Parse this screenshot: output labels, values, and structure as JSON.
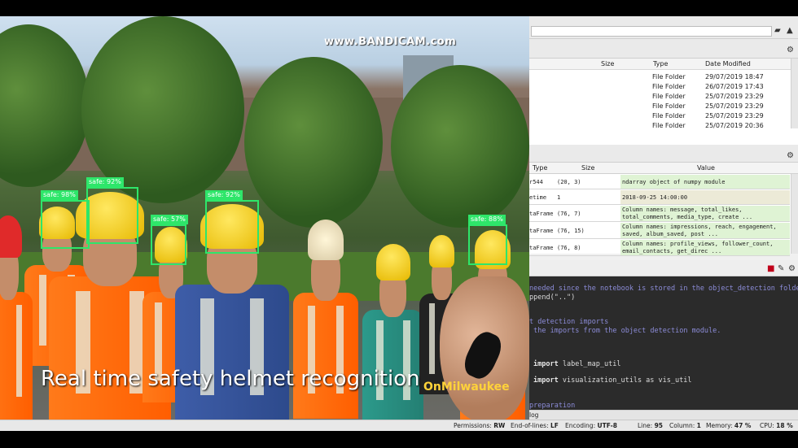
{
  "video": {
    "watermark": "www.BANDICAM.com",
    "caption": "Real time safety helmet recognition",
    "logo_text": "OnMilwaukee",
    "detections": [
      {
        "label": "safe: 98%"
      },
      {
        "label": "safe: 92%"
      },
      {
        "label": "safe: 57%"
      },
      {
        "label": "safe: 92%"
      },
      {
        "label": "safe: 88%"
      }
    ]
  },
  "file_explorer": {
    "columns": {
      "size": "Size",
      "type": "Type",
      "date": "Date Modified"
    },
    "rows": [
      {
        "type": "File Folder",
        "date": "29/07/2019 18:47"
      },
      {
        "type": "File Folder",
        "date": "26/07/2019 17:43"
      },
      {
        "type": "File Folder",
        "date": "25/07/2019 23:29"
      },
      {
        "type": "File Folder",
        "date": "25/07/2019 23:29"
      },
      {
        "type": "File Folder",
        "date": "25/07/2019 23:29"
      },
      {
        "type": "File Folder",
        "date": "25/07/2019 20:36"
      }
    ]
  },
  "variable_explorer": {
    "columns": {
      "type": "Type",
      "size": "Size",
      "value": "Value"
    },
    "rows": [
      {
        "name": "r544",
        "size": "(20, 3)",
        "value": "ndarray object of numpy module",
        "value2": "",
        "color": "#dff3d4"
      },
      {
        "name": "etime",
        "size": "1",
        "value": "2018-09-25 14:00:00",
        "value2": "",
        "color": "#ecead7"
      },
      {
        "name": "taFrame",
        "size": "(76, 7)",
        "value": "Column names: message, total_likes,",
        "value2": "total_comments, media_type, create ...",
        "color": "#dff3d4"
      },
      {
        "name": "taFrame",
        "size": "(76, 15)",
        "value": "Column names: impressions, reach, engagement,",
        "value2": "saved, album_saved, post ...",
        "color": "#dff3d4"
      },
      {
        "name": "taFrame",
        "size": "(76, 8)",
        "value": "Column names: profile_views, follower_count,",
        "value2": "email_contacts, get_direc ...",
        "color": "#dff3d4"
      }
    ]
  },
  "editor": {
    "lines": [
      {
        "kind": "comment",
        "text": "needed since the notebook is stored in the object_detection folder."
      },
      {
        "kind": "plain",
        "text": "ppend(\"..\")"
      },
      {
        "kind": "comment",
        "text": "t detection imports"
      },
      {
        "kind": "comment",
        "text": " the imports from the object detection module."
      },
      {
        "kind": "kw",
        "text": "import",
        "rest": " label_map_util"
      },
      {
        "kind": "kw",
        "text": "import",
        "rest": " visualization_utils as vis_util"
      },
      {
        "kind": "comment",
        "text": "preparation"
      }
    ]
  },
  "panel_tab": {
    "log": "log"
  },
  "statusbar": {
    "permissions_label": "Permissions:",
    "permissions_value": "RW",
    "eol_label": "End-of-lines:",
    "eol_value": "LF",
    "encoding_label": "Encoding:",
    "encoding_value": "UTF-8",
    "line_label": "Line:",
    "line_value": "95",
    "column_label": "Column:",
    "column_value": "1",
    "memory_label": "Memory:",
    "memory_value": "47 %",
    "cpu_label": "CPU:",
    "cpu_value": "18 %"
  }
}
